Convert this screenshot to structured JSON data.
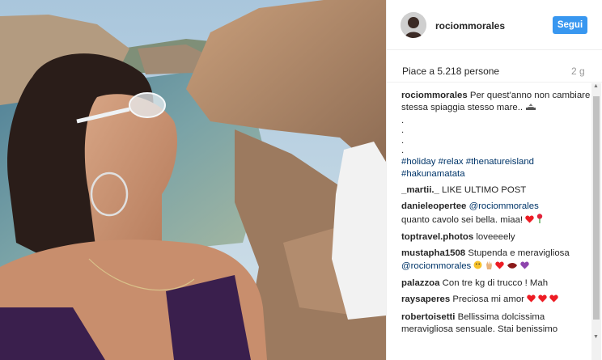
{
  "post": {
    "username": "rociommorales",
    "follow_label": "Segui",
    "likes_text": "Piace a 5.218 persone",
    "time_ago": "2 g",
    "caption": {
      "user": "rociommorales",
      "line1": "Per quest'anno non cambiare",
      "line2": "stessa spiaggia stesso mare..",
      "dots": [
        ".",
        ".",
        ".",
        "."
      ],
      "hashtags_line1": "#holiday #relax #thenatureisland",
      "hashtags_line2": "#hakunamatata"
    }
  },
  "comments": [
    {
      "user": "_martii._",
      "text": "LIKE ULTIMO POST"
    },
    {
      "user": "danieleopertee",
      "mention": "@rociommorales",
      "text": "quanto cavolo sei bella. miaa!"
    },
    {
      "user": "toptravel.photos",
      "text": "loveeeely"
    },
    {
      "user": "mustapha1508",
      "text": "Stupenda e meravigliosa",
      "mention": "@rociommorales"
    },
    {
      "user": "palazzoa",
      "text": "Con tre kg di trucco ! Mah"
    },
    {
      "user": "raysaperes",
      "text": "Preciosa mi amor"
    },
    {
      "user": "robertoisetti",
      "text": "Bellissima dolcissima meravigliosa sensuale. Stai benissimo"
    }
  ],
  "icons": {
    "boat": "beach-boat-icon",
    "heart": "heart-emoji-icon",
    "rose": "rose-emoji-icon"
  },
  "colors": {
    "follow_button": "#3897f0",
    "hashtag": "#003569",
    "heart": "#ed1c24"
  }
}
